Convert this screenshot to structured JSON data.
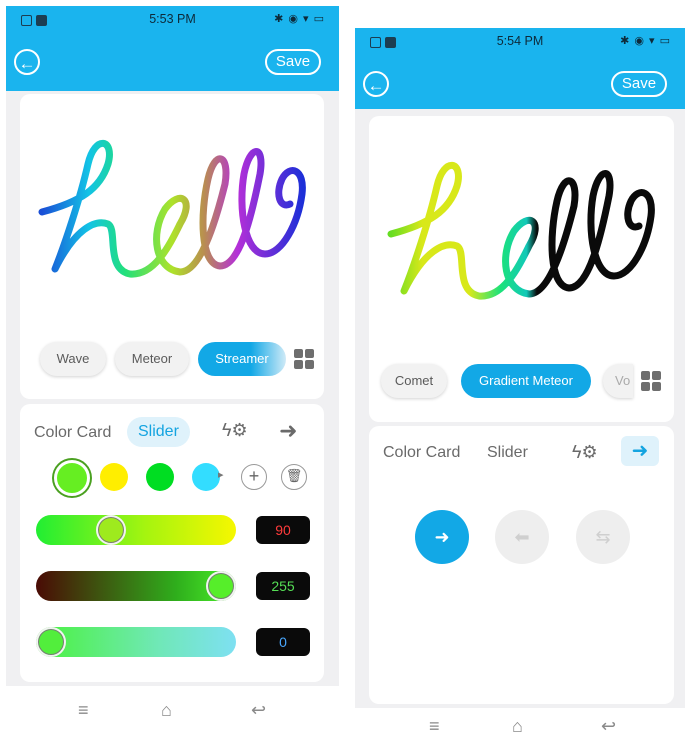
{
  "left": {
    "status": {
      "time": "5:53 PM"
    },
    "save_label": "Save",
    "preview_text": "hello",
    "effects": [
      "Wave",
      "Meteor",
      "Streamer"
    ],
    "tabs": {
      "color_card": "Color Card",
      "slider": "Slider"
    },
    "swatches": [
      "#66ee22",
      "#ffee00",
      "#00dd22",
      "#33ddff"
    ],
    "sliders": [
      {
        "value": "90",
        "color": "#ff3b3b",
        "fill": 0.35
      },
      {
        "value": "255",
        "color": "#55dd55",
        "fill": 1.0
      },
      {
        "value": "0",
        "color": "#4aa8ff",
        "fill": 0.0
      }
    ]
  },
  "right": {
    "status": {
      "time": "5:54 PM"
    },
    "save_label": "Save",
    "preview_text": "hello",
    "effects": [
      "Comet",
      "Gradient Meteor",
      "Vo"
    ],
    "tabs": {
      "color_card": "Color Card",
      "slider": "Slider"
    },
    "directions": [
      "right-arrow-icon",
      "left-arrow-icon",
      "converge-icon"
    ]
  },
  "colors": {
    "accent": "#1ab4ee",
    "active_blue": "#12a8e6"
  }
}
